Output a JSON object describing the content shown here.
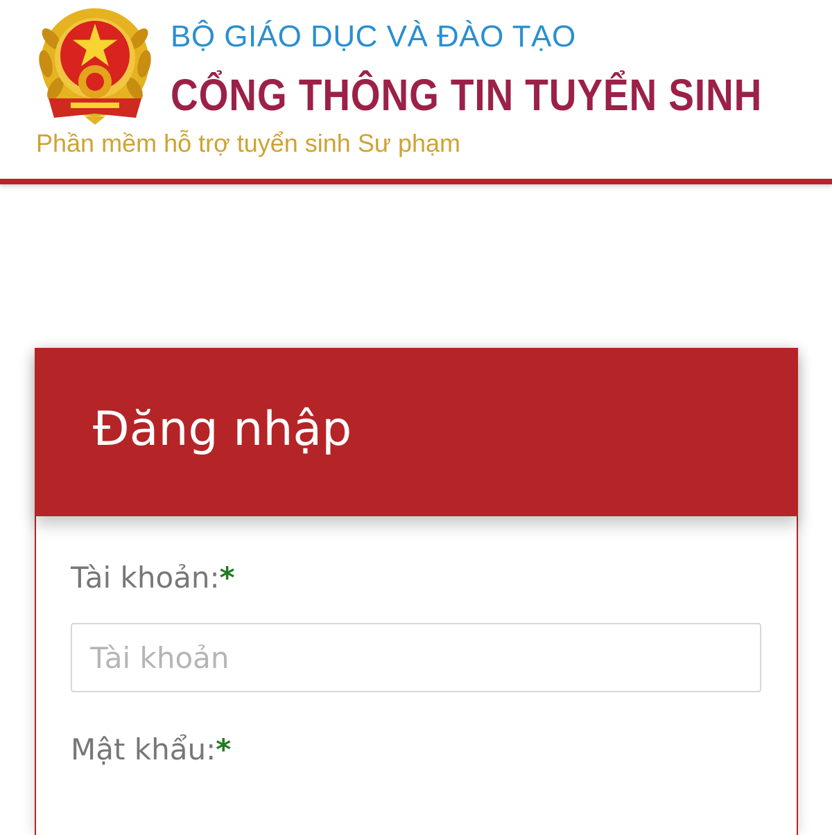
{
  "header": {
    "ministry": "BỘ GIÁO DỤC VÀ ĐÀO TẠO",
    "portal": "CỔNG THÔNG TIN TUYỂN SINH",
    "subtitle": "Phần mềm hỗ trợ tuyển sinh Sư phạm",
    "emblem_icon": "national-emblem-icon",
    "colors": {
      "ministry": "#2a8fd0",
      "portal": "#9b2148",
      "subtitle": "#cda333",
      "rule": "#b82329"
    }
  },
  "login": {
    "title": "Đăng nhập",
    "header_color": "#b52426",
    "username": {
      "label": "Tài khoản:",
      "required_mark": "*",
      "placeholder": "Tài khoản",
      "value": ""
    },
    "password": {
      "label": "Mật khẩu:",
      "required_mark": "*"
    }
  }
}
